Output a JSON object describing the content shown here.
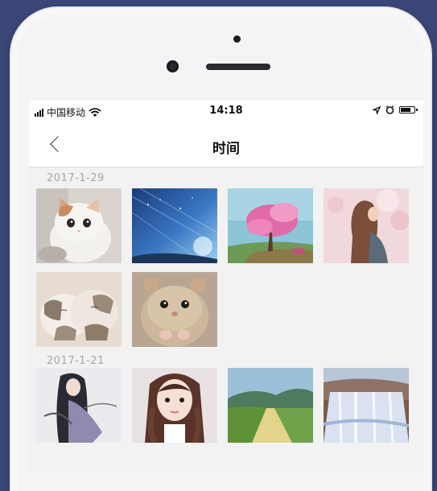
{
  "status_bar": {
    "carrier": "中国移动",
    "time": "14:18"
  },
  "nav": {
    "title": "时间"
  },
  "groups": [
    {
      "date": "2017-1-29",
      "photos": [
        "cat",
        "starry-sky",
        "pink-tree",
        "girl-blossom",
        "sleeping-kittens",
        "hamster"
      ]
    },
    {
      "date": "2017-1-21",
      "photos": [
        "ink-warrior",
        "braided-girl",
        "green-road",
        "waterfall"
      ]
    }
  ],
  "colors": {
    "background": "#3b4778",
    "screen": "#f2f2f2",
    "date_text": "#a8a8a8"
  }
}
